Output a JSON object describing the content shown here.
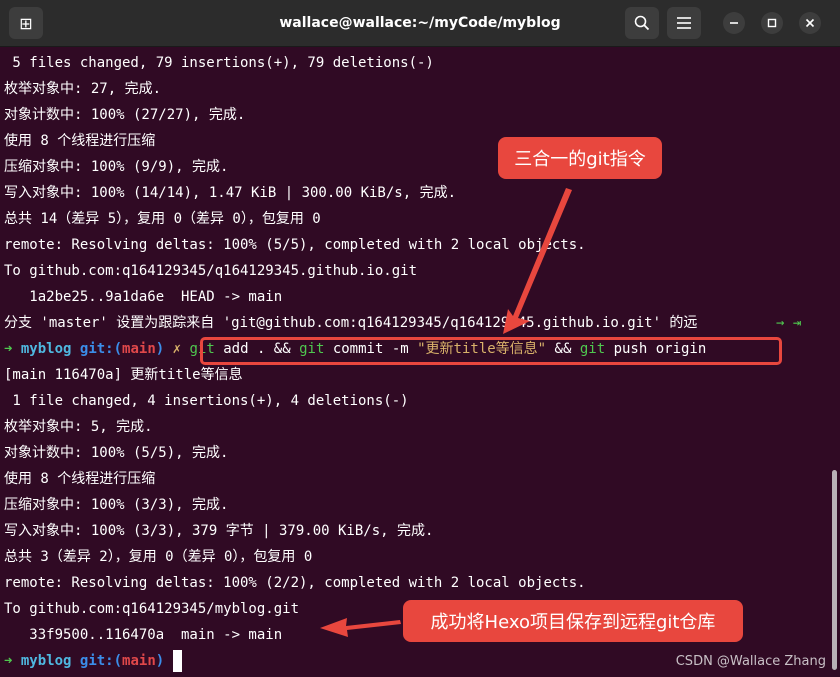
{
  "window": {
    "title": "wallace@wallace:~/myCode/myblog",
    "new_tab_icon": "new-tab-icon",
    "search_icon": "search-icon",
    "menu_icon": "hamburger-menu-icon",
    "minimize_icon": "minimize-icon",
    "maximize_icon": "maximize-icon",
    "close_icon": "close-icon"
  },
  "terminal": {
    "lines": [
      " 5 files changed, 79 insertions(+), 79 deletions(-)",
      "枚举对象中: 27, 完成.",
      "对象计数中: 100% (27/27), 完成.",
      "使用 8 个线程进行压缩",
      "压缩对象中: 100% (9/9), 完成.",
      "写入对象中: 100% (14/14), 1.47 KiB | 300.00 KiB/s, 完成.",
      "总共 14（差异 5），复用 0（差异 0），包复用 0",
      "remote: Resolving deltas: 100% (5/5), completed with 2 local objects.",
      "To github.com:q164129345/q164129345.github.io.git",
      "   1a2be25..9a1da6e  HEAD -> main",
      "分支 'master' 设置为跟踪来自 'git@github.com:q164129345/q164129345.github.io.git' 的远"
    ],
    "line11_tail": "→ ⇥",
    "prompt1": {
      "arrow": "➜",
      "dir": "myblog",
      "git_label": "git:(",
      "branch": "main",
      "git_close": ")",
      "extra": " ✗",
      "cmd_git1": "git",
      "cmd_part1": " add . && ",
      "cmd_git2": "git",
      "cmd_part2": " commit -m ",
      "cmd_msg": "\"更新title等信息\"",
      "cmd_part3": " && ",
      "cmd_git3": "git",
      "cmd_part4": " push origin"
    },
    "lines2": [
      "[main 116470a] 更新title等信息",
      " 1 file changed, 4 insertions(+), 4 deletions(-)",
      "枚举对象中: 5, 完成.",
      "对象计数中: 100% (5/5), 完成.",
      "使用 8 个线程进行压缩",
      "压缩对象中: 100% (3/3), 完成.",
      "写入对象中: 100% (3/3), 379 字节 | 379.00 KiB/s, 完成.",
      "总共 3（差异 2），复用 0（差异 0），包复用 0",
      "remote: Resolving deltas: 100% (2/2), completed with 2 local objects.",
      "To github.com:q164129345/myblog.git",
      "   33f9500..116470a  main -> main"
    ],
    "prompt2": {
      "arrow": "➜",
      "dir": "myblog",
      "git_label": "git:(",
      "branch": "main",
      "git_close": ")"
    }
  },
  "annotations": {
    "callout_top": "三合一的git指令",
    "callout_bottom": "成功将Hexo项目保存到远程git仓库"
  },
  "watermark": "CSDN @Wallace Zhang",
  "colors": {
    "background": "#300a24",
    "titlebar": "#2c2c2c",
    "annotation": "#e8473e",
    "prompt_arrow": "#4fc84f",
    "dir": "#4fb8e0",
    "git_label": "#3b8eea",
    "branch": "#e0484a"
  }
}
